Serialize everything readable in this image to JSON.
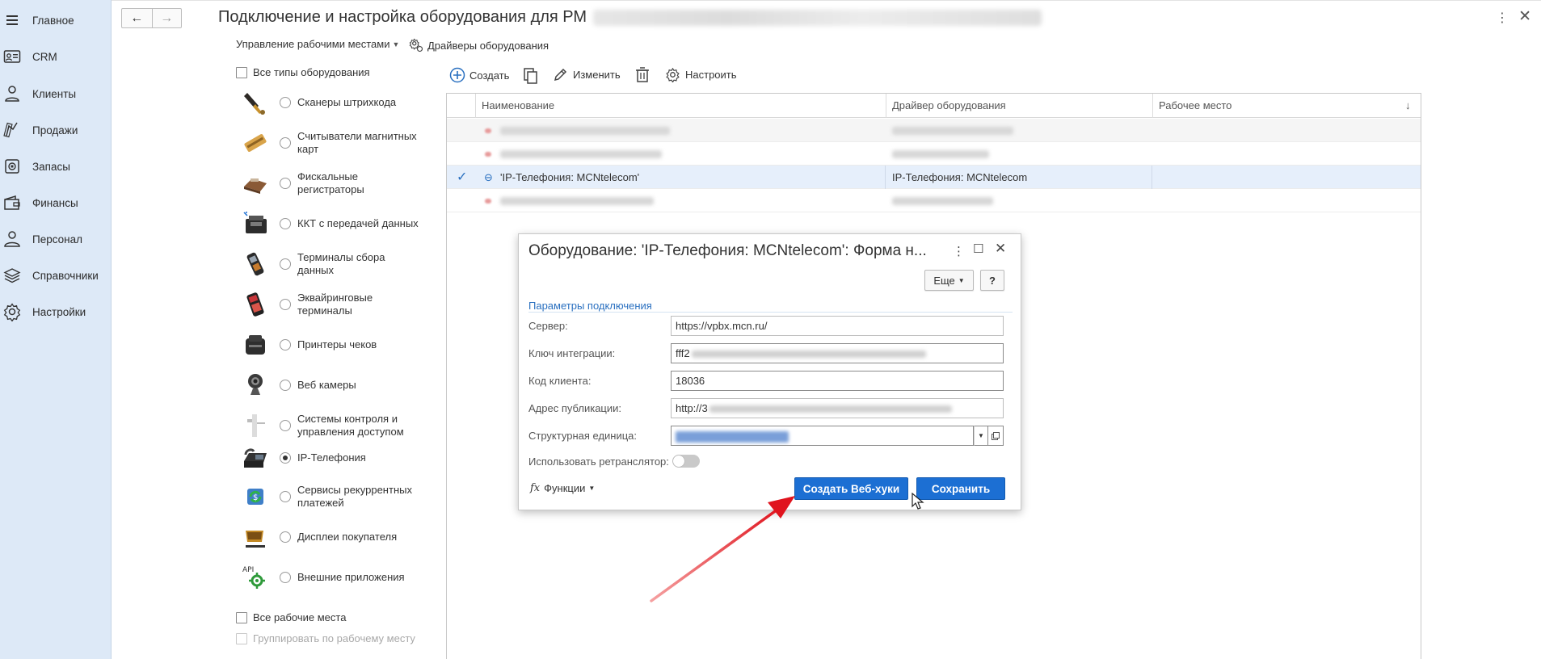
{
  "sidebar": {
    "items": [
      {
        "label": "Главное",
        "icon": "menu-icon"
      },
      {
        "label": "CRM",
        "icon": "crm-card-icon"
      },
      {
        "label": "Клиенты",
        "icon": "clients-icon"
      },
      {
        "label": "Продажи",
        "icon": "sales-icon"
      },
      {
        "label": "Запасы",
        "icon": "stock-icon"
      },
      {
        "label": "Финансы",
        "icon": "wallet-icon"
      },
      {
        "label": "Персонал",
        "icon": "staff-icon"
      },
      {
        "label": "Справочники",
        "icon": "layers-icon"
      },
      {
        "label": "Настройки",
        "icon": "settings-gear-icon"
      }
    ]
  },
  "header": {
    "back": "←",
    "forward": "→",
    "title": "Подключение и настройка оборудования для РМ",
    "more": "⋮",
    "close": "✕"
  },
  "subtoolbar": {
    "workplaces_label": "Управление рабочими местами",
    "drivers_label": "Драйверы оборудования"
  },
  "filters": {
    "all_types_label": "Все типы оборудования",
    "all_workplaces_label": "Все рабочие места",
    "group_by_workplace_label": "Группировать по рабочему месту"
  },
  "equipment_types": [
    {
      "label": "Сканеры штрихкода",
      "icon": "barcode-scanner-icon",
      "selected": false
    },
    {
      "label": "Считыватели магнитных карт",
      "icon": "card-reader-icon",
      "selected": false
    },
    {
      "label": "Фискальные регистраторы",
      "icon": "fiscal-register-icon",
      "selected": false
    },
    {
      "label": "ККТ с передачей данных",
      "icon": "kkt-icon",
      "selected": false
    },
    {
      "label": "Терминалы сбора данных",
      "icon": "data-terminal-icon",
      "selected": false
    },
    {
      "label": "Эквайринговые терминалы",
      "icon": "acquiring-terminal-icon",
      "selected": false
    },
    {
      "label": "Принтеры чеков",
      "icon": "receipt-printer-icon",
      "selected": false
    },
    {
      "label": "Веб камеры",
      "icon": "webcam-icon",
      "selected": false
    },
    {
      "label": "Системы контроля и управления доступом",
      "icon": "access-control-icon",
      "selected": false
    },
    {
      "label": "IP-Телефония",
      "icon": "ip-phone-icon",
      "selected": true
    },
    {
      "label": "Сервисы рекуррентных платежей",
      "icon": "recurring-payments-icon",
      "selected": false
    },
    {
      "label": "Дисплеи покупателя",
      "icon": "customer-display-icon",
      "selected": false
    },
    {
      "label": "Внешние приложения",
      "icon": "api-icon",
      "selected": false
    }
  ],
  "commands": {
    "create": "Создать",
    "edit": "Изменить",
    "configure": "Настроить"
  },
  "table": {
    "columns": [
      "Наименование",
      "Драйвер оборудования",
      "Рабочее место"
    ],
    "sort_indicator": "↓",
    "selected_row": {
      "check": "✓",
      "name": "'IP-Телефония: MCNtelecom'",
      "driver": "IP-Телефония: MCNtelecom",
      "workplace": ""
    }
  },
  "dialog": {
    "title": "Оборудование: 'IP-Телефония: MCNtelecom': Форма н...",
    "more_button": "Еще",
    "help_button": "?",
    "section_label": "Параметры подключения",
    "fields": {
      "server": {
        "label": "Сервер:",
        "value": "https://vpbx.mcn.ru/"
      },
      "integration_key": {
        "label": "Ключ интеграции:",
        "value": "fff2"
      },
      "client_code": {
        "label": "Код клиента:",
        "value": "18036"
      },
      "publication_address": {
        "label": "Адрес публикации:",
        "value": "http://3"
      },
      "structural_unit": {
        "label": "Структурная единица:",
        "value": ""
      },
      "use_relay": {
        "label": "Использовать ретранслятор:",
        "value": false
      }
    },
    "functions_label": "Функции",
    "create_webhooks_button": "Создать Веб-хуки",
    "save_button": "Сохранить"
  },
  "colors": {
    "sidebar_bg": "#dde9f7",
    "primary": "#1c6fd3",
    "link": "#2a70c0",
    "selected_row": "#e6effb",
    "annotation_arrow": "#e0141e"
  }
}
